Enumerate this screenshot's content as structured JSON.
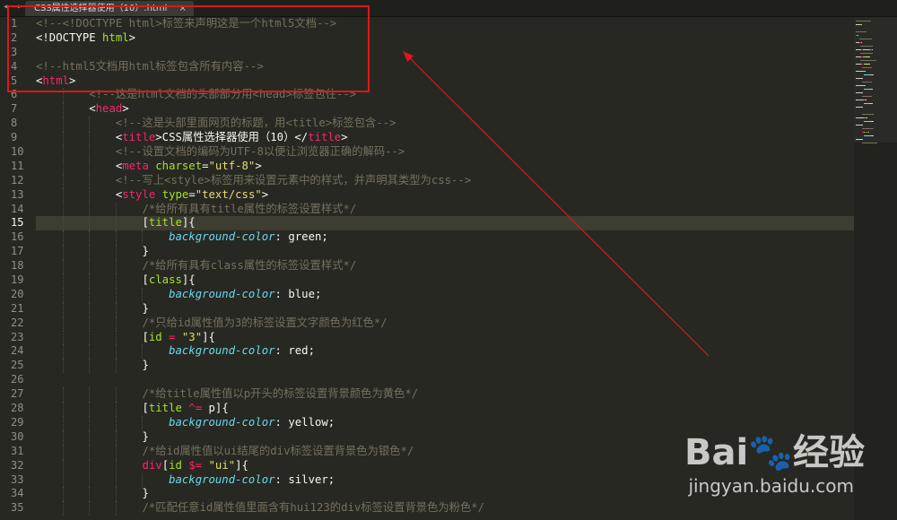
{
  "tab": {
    "title": "CSS属性选择器使用（10）.html",
    "close": "×"
  },
  "current_line": 15,
  "lines": [
    [
      [
        "c",
        "<!--<!DOCTYPE html>标签来声明这是一个html5文档-->"
      ]
    ],
    [
      [
        "w",
        "<!DOCTYPE "
      ],
      [
        "a",
        "html"
      ],
      [
        "w",
        ">"
      ]
    ],
    [],
    [
      [
        "c",
        "<!--html5文档用html标签包含所有内容-->"
      ]
    ],
    [
      [
        "w",
        "<"
      ],
      [
        "t",
        "html"
      ],
      [
        "w",
        ">"
      ]
    ],
    [
      [
        "w",
        "        "
      ],
      [
        "c",
        "<!--这是html文档的头部部分用<head>标签包住-->"
      ]
    ],
    [
      [
        "w",
        "        <"
      ],
      [
        "t",
        "head"
      ],
      [
        "w",
        ">"
      ]
    ],
    [
      [
        "w",
        "            "
      ],
      [
        "c",
        "<!--这是头部里面网页的标题，用<title>标签包含-->"
      ]
    ],
    [
      [
        "w",
        "            <"
      ],
      [
        "t",
        "title"
      ],
      [
        "w",
        ">CSS属性选择器使用（10）</"
      ],
      [
        "t",
        "title"
      ],
      [
        "w",
        ">"
      ]
    ],
    [
      [
        "w",
        "            "
      ],
      [
        "c",
        "<!--设置文档的编码为UTF-8以便让浏览器正确的解码-->"
      ]
    ],
    [
      [
        "w",
        "            <"
      ],
      [
        "t",
        "meta"
      ],
      [
        "w",
        " "
      ],
      [
        "a",
        "charset"
      ],
      [
        "w",
        "="
      ],
      [
        "s",
        "\"utf-8\""
      ],
      [
        "w",
        ">"
      ]
    ],
    [
      [
        "w",
        "            "
      ],
      [
        "c",
        "<!--写上<style>标签用来设置元素中的样式，并声明其类型为css-->"
      ]
    ],
    [
      [
        "w",
        "            <"
      ],
      [
        "t",
        "style"
      ],
      [
        "w",
        " "
      ],
      [
        "a",
        "type"
      ],
      [
        "w",
        "="
      ],
      [
        "s",
        "\"text/css\""
      ],
      [
        "w",
        ">"
      ]
    ],
    [
      [
        "w",
        "                "
      ],
      [
        "c",
        "/*给所有具有title属性的标签设置样式*/"
      ]
    ],
    [
      [
        "w",
        "                ["
      ],
      [
        "a",
        "title"
      ],
      [
        "w",
        "]{"
      ]
    ],
    [
      [
        "w",
        "                    "
      ],
      [
        "p",
        "background-color"
      ],
      [
        "w",
        ": green;"
      ]
    ],
    [
      [
        "w",
        "                }"
      ]
    ],
    [
      [
        "w",
        "                "
      ],
      [
        "c",
        "/*给所有具有class属性的标签设置样式*/"
      ]
    ],
    [
      [
        "w",
        "                ["
      ],
      [
        "a",
        "class"
      ],
      [
        "w",
        "]{"
      ]
    ],
    [
      [
        "w",
        "                    "
      ],
      [
        "p",
        "background-color"
      ],
      [
        "w",
        ": blue;"
      ]
    ],
    [
      [
        "w",
        "                }"
      ]
    ],
    [
      [
        "w",
        "                "
      ],
      [
        "c",
        "/*只给id属性值为3的标签设置文字颜色为红色*/"
      ]
    ],
    [
      [
        "w",
        "                ["
      ],
      [
        "a",
        "id"
      ],
      [
        "w",
        " "
      ],
      [
        "t",
        "="
      ],
      [
        "w",
        " "
      ],
      [
        "s",
        "\"3\""
      ],
      [
        "w",
        "]{"
      ]
    ],
    [
      [
        "w",
        "                    "
      ],
      [
        "p",
        "background-color"
      ],
      [
        "w",
        ": red;"
      ]
    ],
    [
      [
        "w",
        "                }"
      ]
    ],
    [],
    [
      [
        "w",
        "                "
      ],
      [
        "c",
        "/*给title属性值以p开头的标签设置背景颜色为黄色*/"
      ]
    ],
    [
      [
        "w",
        "                ["
      ],
      [
        "a",
        "title"
      ],
      [
        "w",
        " "
      ],
      [
        "t",
        "^="
      ],
      [
        "w",
        " p]{"
      ]
    ],
    [
      [
        "w",
        "                    "
      ],
      [
        "p",
        "background-color"
      ],
      [
        "w",
        ": yellow;"
      ]
    ],
    [
      [
        "w",
        "                }"
      ]
    ],
    [
      [
        "w",
        "                "
      ],
      [
        "c",
        "/*给id属性值以ui结尾的div标签设置背景色为银色*/"
      ]
    ],
    [
      [
        "w",
        "                "
      ],
      [
        "t",
        "div"
      ],
      [
        "w",
        "["
      ],
      [
        "a",
        "id"
      ],
      [
        "w",
        " "
      ],
      [
        "t",
        "$="
      ],
      [
        "w",
        " "
      ],
      [
        "s",
        "\"ui\""
      ],
      [
        "w",
        "]{"
      ]
    ],
    [
      [
        "w",
        "                    "
      ],
      [
        "p",
        "background-color"
      ],
      [
        "w",
        ": silver;"
      ]
    ],
    [
      [
        "w",
        "                }"
      ]
    ],
    [
      [
        "w",
        "                "
      ],
      [
        "c",
        "/*匹配任意id属性值里面含有hui123的div标签设置背景色为粉色*/"
      ]
    ]
  ],
  "watermark": {
    "logo_a": "Bai",
    "logo_paw": "🐾",
    "logo_b": "经验",
    "url": "jingyan.baidu.com"
  },
  "colors": {
    "annotation": "#e0161b",
    "comment": "#75715e",
    "keyword": "#f92672",
    "attribute": "#a6e22e",
    "string": "#e6db74",
    "property": "#66d9ef"
  }
}
